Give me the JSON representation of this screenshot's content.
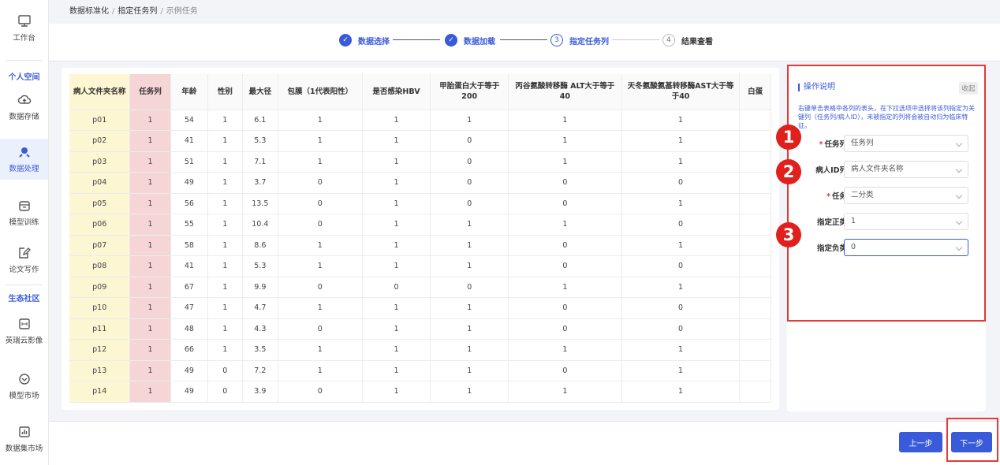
{
  "breadcrumb": [
    "数据标准化",
    "指定任务列",
    "示例任务"
  ],
  "sidebar": {
    "items": [
      {
        "label": "工作台",
        "icon": "monitor-icon"
      },
      {
        "label": "数据存储",
        "icon": "cloud-upload-icon"
      },
      {
        "label": "数据处理",
        "icon": "data-process-icon"
      },
      {
        "label": "模型训练",
        "icon": "model-train-icon"
      },
      {
        "label": "论文写作",
        "icon": "edit-doc-icon"
      },
      {
        "label": "英瑞云影像",
        "icon": "image-box-icon"
      },
      {
        "label": "模型市场",
        "icon": "cube-icon"
      },
      {
        "label": "数据集市场",
        "icon": "bar-chart-icon"
      }
    ],
    "sections": [
      "个人空间",
      "生态社区"
    ]
  },
  "steps": [
    {
      "label": "数据选择",
      "num": "✓",
      "state": "done"
    },
    {
      "label": "数据加载",
      "num": "✓",
      "state": "done"
    },
    {
      "label": "指定任务列",
      "num": "3",
      "state": "current"
    },
    {
      "label": "结果查看",
      "num": "4",
      "state": "todo"
    }
  ],
  "table": {
    "headers": [
      "病人文件夹名称",
      "任务列",
      "年龄",
      "性别",
      "最大径",
      "包膜（1代表阳性）",
      "是否感染HBV",
      "甲胎蛋白大于等于200",
      "丙谷氨酸转移酶 ALT大于等于40",
      "天冬氨酸氨基转移酶AST大于等于40",
      "白蛋"
    ],
    "rows": [
      [
        "p01",
        "1",
        "54",
        "1",
        "6.1",
        "1",
        "1",
        "1",
        "1",
        "1"
      ],
      [
        "p02",
        "1",
        "41",
        "1",
        "5.3",
        "1",
        "1",
        "0",
        "1",
        "1"
      ],
      [
        "p03",
        "1",
        "51",
        "1",
        "7.1",
        "1",
        "1",
        "0",
        "1",
        "1"
      ],
      [
        "p04",
        "1",
        "49",
        "1",
        "3.7",
        "0",
        "1",
        "0",
        "0",
        "0"
      ],
      [
        "p05",
        "1",
        "56",
        "1",
        "13.5",
        "0",
        "1",
        "0",
        "0",
        "1"
      ],
      [
        "p06",
        "1",
        "55",
        "1",
        "10.4",
        "0",
        "1",
        "1",
        "1",
        "0"
      ],
      [
        "p07",
        "1",
        "58",
        "1",
        "8.6",
        "1",
        "1",
        "1",
        "0",
        "1"
      ],
      [
        "p08",
        "1",
        "41",
        "1",
        "5.3",
        "1",
        "1",
        "1",
        "0",
        "0"
      ],
      [
        "p09",
        "1",
        "67",
        "1",
        "9.9",
        "0",
        "0",
        "0",
        "1",
        "1"
      ],
      [
        "p10",
        "1",
        "47",
        "1",
        "4.7",
        "1",
        "1",
        "1",
        "0",
        "0"
      ],
      [
        "p11",
        "1",
        "48",
        "1",
        "4.3",
        "0",
        "1",
        "1",
        "0",
        "0"
      ],
      [
        "p12",
        "1",
        "66",
        "1",
        "3.5",
        "1",
        "1",
        "1",
        "1",
        "1"
      ],
      [
        "p13",
        "1",
        "49",
        "0",
        "7.2",
        "1",
        "1",
        "1",
        "0",
        "1"
      ],
      [
        "p14",
        "1",
        "49",
        "0",
        "3.9",
        "0",
        "1",
        "1",
        "1",
        "1"
      ]
    ]
  },
  "panel": {
    "title": "操作说明",
    "collapse": "收起",
    "description": "右键单击表格中各列的表头，在下拉选项中选择将该列指定为关键列（任务列/病人ID），未被指定的列将会被自动归为临床特征。",
    "fields": [
      {
        "label": "任务列",
        "value": "任务列",
        "required": "*"
      },
      {
        "label": "病人ID列",
        "value": "病人文件夹名称",
        "required": ""
      },
      {
        "label": "任务",
        "value": "二分类",
        "required": "*"
      },
      {
        "label": "指定正类",
        "value": "1",
        "required": ""
      },
      {
        "label": "指定负类",
        "value": "0",
        "required": ""
      }
    ],
    "badges": [
      "1",
      "2",
      "3"
    ]
  },
  "footer": {
    "prev": "上一步",
    "next": "下一步"
  },
  "colors": {
    "accent": "#3a5bd9",
    "highlight_red": "#e53935",
    "pid_col": "#fdf6d3",
    "task_col": "#f6d5d7"
  }
}
